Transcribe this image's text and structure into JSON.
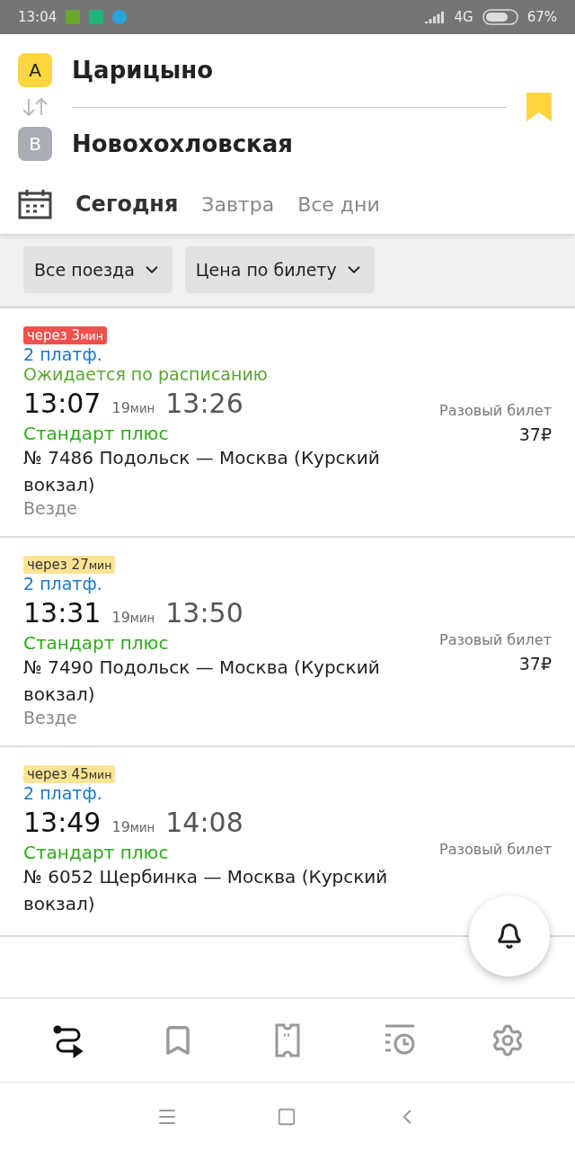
{
  "status_bar": {
    "time": "13:04",
    "network": "4G",
    "battery": "67%"
  },
  "route": {
    "from": {
      "letter": "A",
      "name": "Царицыно"
    },
    "to": {
      "letter": "B",
      "name": "Новохохловская"
    },
    "saved": true
  },
  "days": [
    {
      "label": "Сегодня",
      "selected": true
    },
    {
      "label": "Завтра",
      "selected": false
    },
    {
      "label": "Все дни",
      "selected": false
    }
  ],
  "filters": [
    "Все поезда",
    "Цена по билету"
  ],
  "trains": [
    {
      "badge": {
        "text": "через 3",
        "unit": "мин",
        "kind": "urgent"
      },
      "platform": "2 платф.",
      "status": "Ожидается по расписанию",
      "depart": "13:07",
      "duration": "19",
      "duration_unit": "мин",
      "arrive": "13:26",
      "category": "Стандарт плюс",
      "route": "№ 7486 Подольск — Москва (Курский вокзал)",
      "note": "Везде",
      "ticket": "Разовый билет",
      "price": "37₽"
    },
    {
      "badge": {
        "text": "через 27",
        "unit": "мин",
        "kind": "soon"
      },
      "platform": "2 платф.",
      "depart": "13:31",
      "duration": "19",
      "duration_unit": "мин",
      "arrive": "13:50",
      "category": "Стандарт плюс",
      "route": "№ 7490 Подольск — Москва (Курский вокзал)",
      "note": "Везде",
      "ticket": "Разовый билет",
      "price": "37₽"
    },
    {
      "badge": {
        "text": "через 45",
        "unit": "мин",
        "kind": "soon"
      },
      "platform": "2 платф.",
      "depart": "13:49",
      "duration": "19",
      "duration_unit": "мин",
      "arrive": "14:08",
      "category": "Стандарт плюс",
      "route": "№ 6052 Щербинка — Москва (Курский вокзал)",
      "ticket": "Разовый билет"
    }
  ],
  "nav": [
    {
      "kind": "route",
      "selected": true
    },
    {
      "kind": "bookmark",
      "selected": false
    },
    {
      "kind": "ticket",
      "selected": false
    },
    {
      "kind": "history",
      "selected": false
    },
    {
      "kind": "settings",
      "selected": false
    }
  ]
}
